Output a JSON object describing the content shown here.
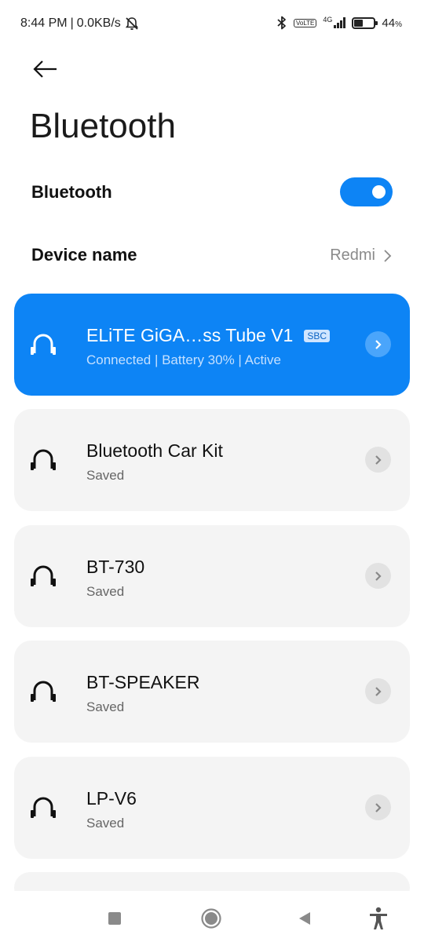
{
  "statusbar": {
    "time": "8:44 PM",
    "speed": "0.0KB/s",
    "network": "4G",
    "volte_label": "VoLTE",
    "battery": "44",
    "battery_pct_symbol": "%",
    "battery_level": 0.44,
    "icons": [
      "mute-icon",
      "bluetooth-icon",
      "signal-icon",
      "battery-icon"
    ]
  },
  "header": {
    "back_icon": "arrow-left-icon",
    "title": "Bluetooth"
  },
  "bluetooth_row": {
    "label": "Bluetooth",
    "enabled": true,
    "accent": "#0d84f5"
  },
  "device_name_row": {
    "label": "Device name",
    "value": "Redmi"
  },
  "devices": [
    {
      "name": "ELiTE GiGA…ss Tube V1",
      "codec": "SBC",
      "status": "Connected | Battery 30%  | Active",
      "active": true,
      "icon": "headphones-icon"
    },
    {
      "name": "Bluetooth Car Kit",
      "status": "Saved",
      "active": false,
      "icon": "headphones-icon"
    },
    {
      "name": "BT-730",
      "status": "Saved",
      "active": false,
      "icon": "headphones-icon"
    },
    {
      "name": "BT-SPEAKER",
      "status": "Saved",
      "active": false,
      "icon": "headphones-icon"
    },
    {
      "name": "LP-V6",
      "status": "Saved",
      "active": false,
      "icon": "headphones-icon"
    }
  ],
  "navbar": {
    "icons": [
      "recents-icon",
      "home-icon",
      "back-triangle-icon",
      "accessibility-icon"
    ]
  }
}
